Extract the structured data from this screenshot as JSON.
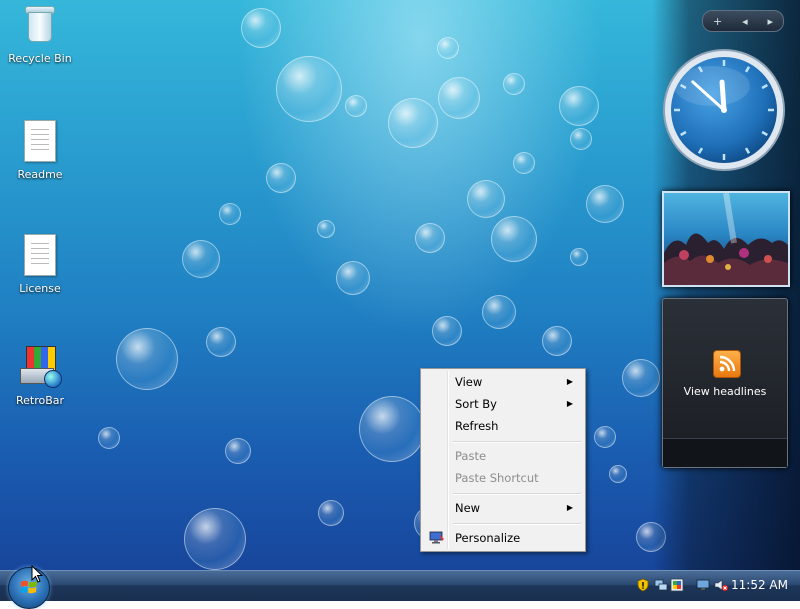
{
  "desktop": {
    "icons": [
      {
        "label": "Recycle Bin",
        "icon": "recycle-bin-icon"
      },
      {
        "label": "Readme",
        "icon": "text-document-icon"
      },
      {
        "label": "License",
        "icon": "text-document-icon"
      },
      {
        "label": "RetroBar",
        "icon": "retrobar-icon"
      }
    ]
  },
  "sidebar": {
    "controls": {
      "add": "+",
      "prev": "◂",
      "next": "▸"
    },
    "clock": {
      "hour": 11,
      "minute": 52,
      "face_color": "#1e6fb8"
    },
    "feed": {
      "label": "View headlines",
      "icon": "rss-icon"
    }
  },
  "context_menu": {
    "items": [
      {
        "label": "View",
        "submenu": true,
        "enabled": true
      },
      {
        "label": "Sort By",
        "submenu": true,
        "enabled": true
      },
      {
        "label": "Refresh",
        "submenu": false,
        "enabled": true
      },
      {
        "label": "Paste",
        "submenu": false,
        "enabled": false
      },
      {
        "label": "Paste Shortcut",
        "submenu": false,
        "enabled": false
      },
      {
        "label": "New",
        "submenu": true,
        "enabled": true
      },
      {
        "label": "Personalize",
        "submenu": false,
        "enabled": true,
        "icon": "personalize-icon"
      }
    ],
    "submenu_arrow": "▶"
  },
  "taskbar": {
    "start_icon": "windows-logo-icon",
    "tray_icons": [
      "security-shield-icon",
      "network-icon",
      "windows-update-icon",
      "display-icon",
      "volume-muted-icon"
    ],
    "time": "11:52 AM"
  }
}
